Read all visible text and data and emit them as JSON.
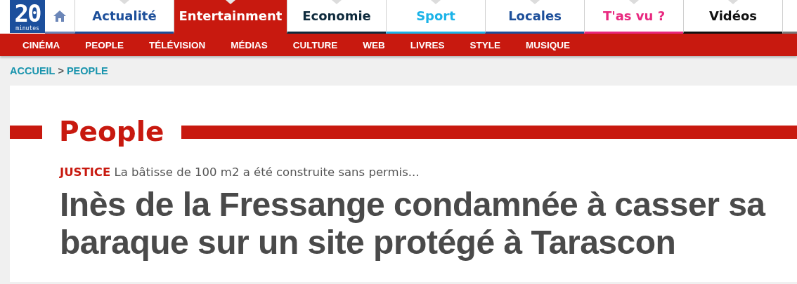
{
  "logo": {
    "number": "20",
    "word": "minutes"
  },
  "tabs": [
    {
      "label": "Actualité",
      "color": "#1d4f9a",
      "selected": false
    },
    {
      "label": "Entertainment",
      "color": "#c8190f",
      "selected": true
    },
    {
      "label": "Economie",
      "color": "#0e2a3c",
      "selected": false
    },
    {
      "label": "Sport",
      "color": "#1bb3e8",
      "selected": false
    },
    {
      "label": "Locales",
      "color": "#1d4f9a",
      "selected": false
    },
    {
      "label": "T'as vu ?",
      "color": "#e8287f",
      "selected": false
    },
    {
      "label": "Vidéos",
      "color": "#111111",
      "selected": false
    }
  ],
  "subnav": [
    "CINÉMA",
    "PEOPLE",
    "TÉLÉVISION",
    "MÉDIAS",
    "CULTURE",
    "WEB",
    "LIVRES",
    "STYLE",
    "MUSIQUE"
  ],
  "breadcrumb": [
    {
      "label": "ACCUEIL"
    },
    {
      "label": "PEOPLE"
    }
  ],
  "breadcrumb_separator": ">",
  "section_title": "People",
  "article": {
    "kicker": "JUSTICE",
    "summary": "La bâtisse de 100 m2 a été construite sans permis...",
    "headline": "Inès de la Fressange condamnée à casser sa baraque sur un site protégé à Tarascon"
  }
}
